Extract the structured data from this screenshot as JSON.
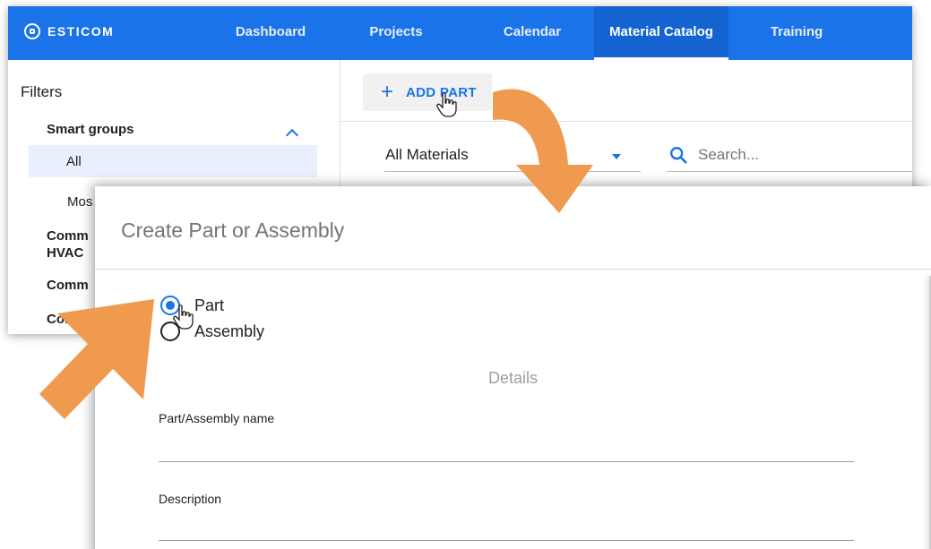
{
  "navbar": {
    "brand": "ESTICOM",
    "tabs": [
      {
        "label": "Dashboard",
        "active": false
      },
      {
        "label": "Projects",
        "active": false
      },
      {
        "label": "Calendar",
        "active": false
      },
      {
        "label": "Material Catalog",
        "active": true
      },
      {
        "label": "Training",
        "active": false
      }
    ]
  },
  "sidebar": {
    "title": "Filters",
    "smart_groups": {
      "header": "Smart groups",
      "items": [
        "All",
        "Mos"
      ]
    },
    "groups": [
      "Comm",
      "HVAC",
      "Comm",
      "Comm"
    ]
  },
  "toolbar": {
    "add_part_icon": "+",
    "add_part_label": "ADD PART",
    "material_filter": "All Materials",
    "search_placeholder": "Search..."
  },
  "dialog": {
    "title": "Create Part or Assembly",
    "type_options": [
      {
        "label": "Part",
        "selected": true
      },
      {
        "label": "Assembly",
        "selected": false
      }
    ],
    "details_heading": "Details",
    "fields": [
      {
        "label": "Part/Assembly name",
        "value": ""
      },
      {
        "label": "Description",
        "value": ""
      }
    ]
  },
  "colors": {
    "primary": "#1a73e8",
    "active_tab": "#1463d0",
    "annotation_arrow": "#ef9a4f",
    "selected_row": "#e8f0fe"
  }
}
